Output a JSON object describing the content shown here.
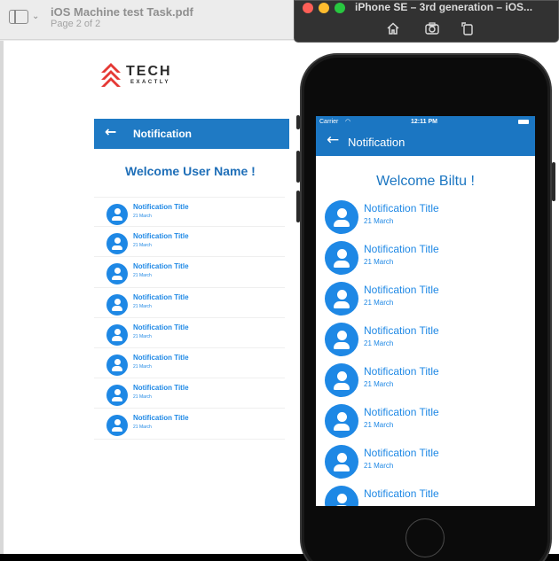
{
  "preview": {
    "title": "iOS Machine test Task.pdf",
    "subtitle": "Page 2 of 2"
  },
  "logo": {
    "text": "TECH",
    "subtext": "EXACTLY"
  },
  "mockup": {
    "nav_title": "Notification",
    "welcome": "Welcome User Name !",
    "items": [
      {
        "title": "Notification Title",
        "date": "21 March"
      },
      {
        "title": "Notification Title",
        "date": "21 March"
      },
      {
        "title": "Notification Title",
        "date": "21 March"
      },
      {
        "title": "Notification Title",
        "date": "21 March"
      },
      {
        "title": "Notification Title",
        "date": "21 March"
      },
      {
        "title": "Notification Title",
        "date": "21 March"
      },
      {
        "title": "Notification Title",
        "date": "21 March"
      },
      {
        "title": "Notification Title",
        "date": "21 March"
      }
    ]
  },
  "simulator": {
    "title": "iPhone SE – 3rd generation – iOS...",
    "status": {
      "carrier": "Carrier",
      "time": "12:11 PM"
    },
    "nav_title": "Notification",
    "welcome": "Welcome Biltu !",
    "items": [
      {
        "title": "Notification Title",
        "date": "21 March"
      },
      {
        "title": "Notification Title",
        "date": "21 March"
      },
      {
        "title": "Notification Title",
        "date": "21 March"
      },
      {
        "title": "Notification Title",
        "date": "21 March"
      },
      {
        "title": "Notification Title",
        "date": "21 March"
      },
      {
        "title": "Notification Title",
        "date": "21 March"
      },
      {
        "title": "Notification Title",
        "date": "21 March"
      },
      {
        "title": "Notification Title",
        "date": ""
      }
    ]
  },
  "colors": {
    "app_blue": "#1b76c2",
    "accent_blue": "#1e88e5",
    "logo_red": "#e53935"
  }
}
